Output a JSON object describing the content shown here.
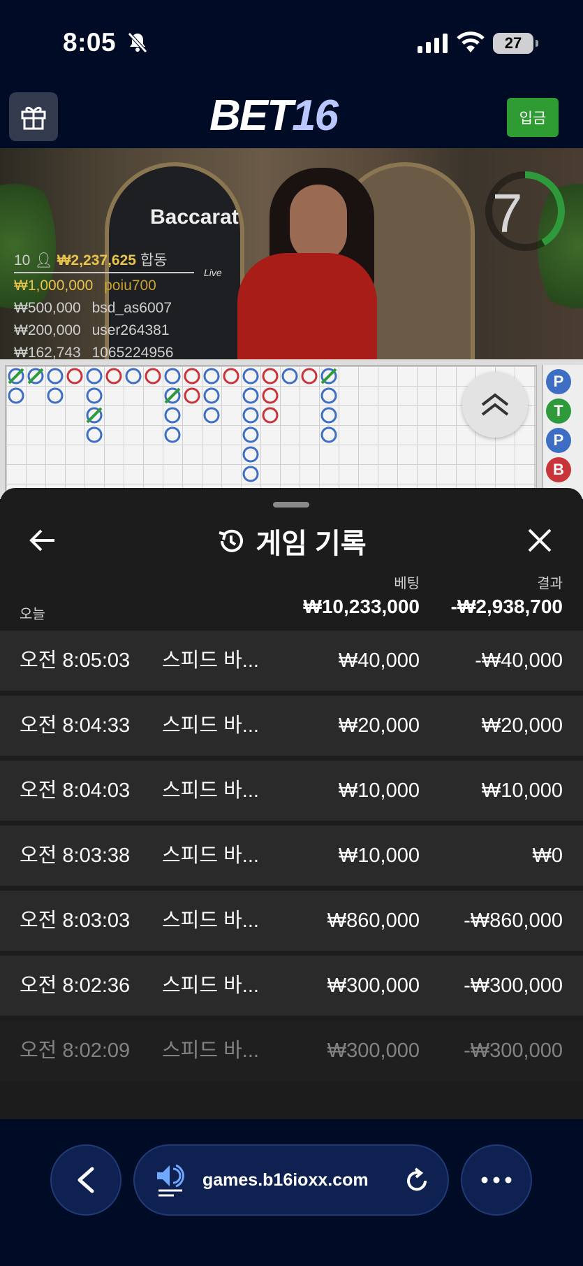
{
  "status_bar": {
    "time": "8:05",
    "battery": "27"
  },
  "header": {
    "logo_part1": "BET",
    "logo_part2": "16",
    "deposit_label": "입금"
  },
  "video": {
    "timer": "7",
    "game_name": "Baccarat",
    "game_sub": "Live",
    "player_count": "10",
    "total_bet": "₩2,237,625",
    "total_suffix": "합동",
    "bettors": [
      {
        "amount": "₩1,000,000",
        "user": "poiu700"
      },
      {
        "amount": "₩500,000",
        "user": "bsd_as6007"
      },
      {
        "amount": "₩200,000",
        "user": "user264381"
      },
      {
        "amount": "₩162,743",
        "user": "1065224956"
      }
    ]
  },
  "roadmap": {
    "side_labels": [
      "P",
      "T",
      "P",
      "B"
    ],
    "colors": {
      "player": "#3d6ec4",
      "banker": "#c8343a",
      "tie": "#2e9a3c"
    }
  },
  "history": {
    "title": "게임 기록",
    "col_bet": "베팅",
    "col_result": "결과",
    "today_label": "오늘",
    "total_bet": "₩10,233,000",
    "total_result": "-₩2,938,700",
    "rows": [
      {
        "time": "오전 8:05:03",
        "game": "스피드 바...",
        "bet": "₩40,000",
        "result": "-₩40,000"
      },
      {
        "time": "오전 8:04:33",
        "game": "스피드 바...",
        "bet": "₩20,000",
        "result": "₩20,000"
      },
      {
        "time": "오전 8:04:03",
        "game": "스피드 바...",
        "bet": "₩10,000",
        "result": "₩10,000"
      },
      {
        "time": "오전 8:03:38",
        "game": "스피드 바...",
        "bet": "₩10,000",
        "result": "₩0"
      },
      {
        "time": "오전 8:03:03",
        "game": "스피드 바...",
        "bet": "₩860,000",
        "result": "-₩860,000"
      },
      {
        "time": "오전 8:02:36",
        "game": "스피드 바...",
        "bet": "₩300,000",
        "result": "-₩300,000"
      },
      {
        "time": "오전 8:02:09",
        "game": "스피드 바...",
        "bet": "₩300,000",
        "result": "-₩300,000"
      }
    ]
  },
  "browser": {
    "url": "games.b16ioxx.com"
  }
}
